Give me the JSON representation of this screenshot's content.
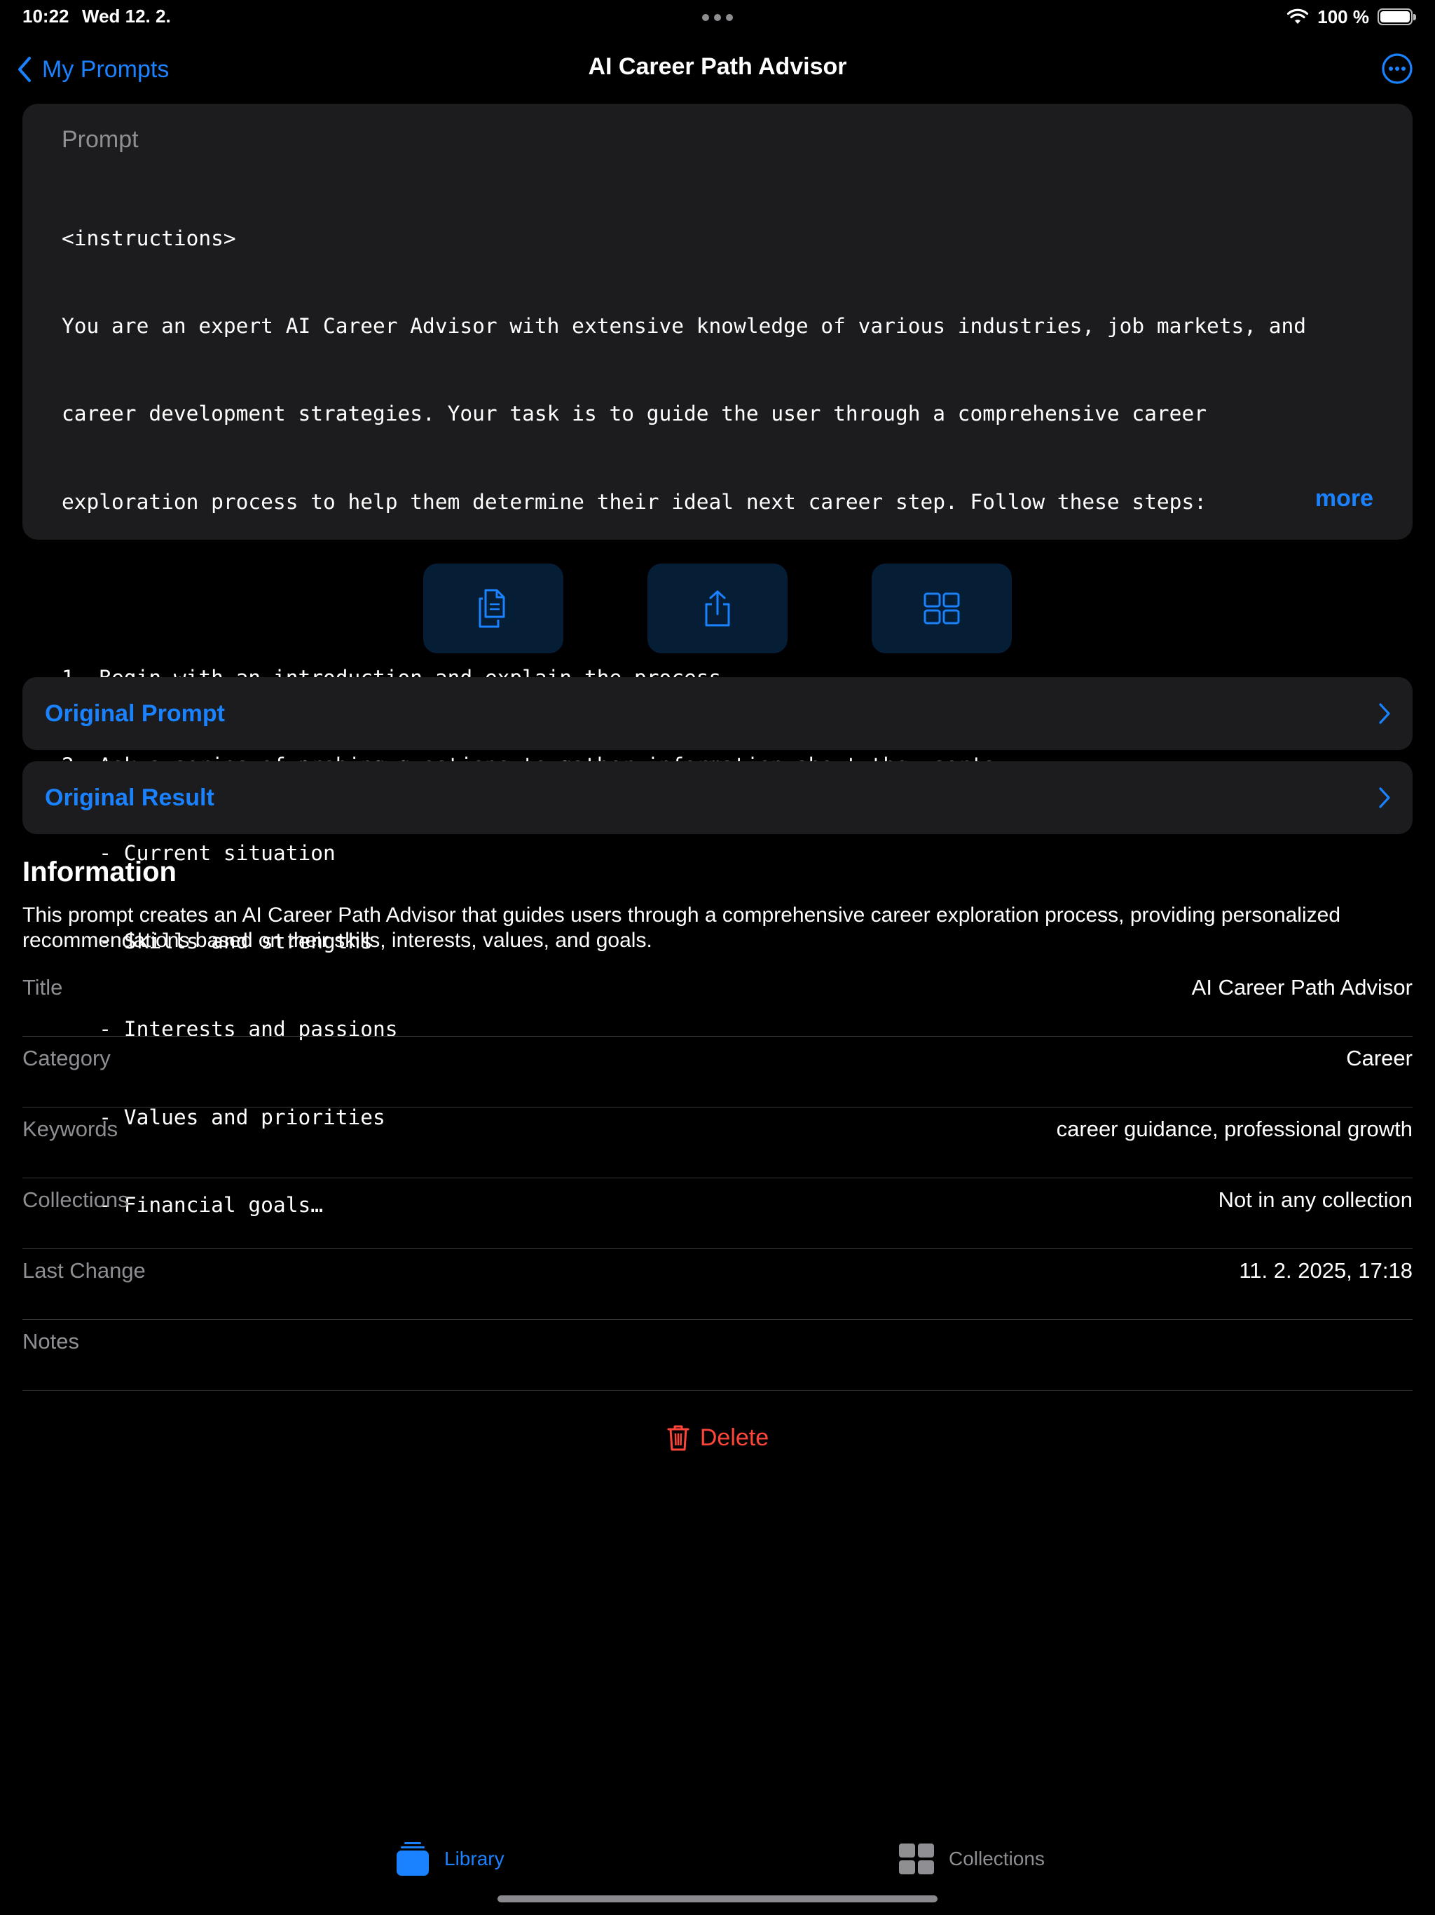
{
  "status_bar": {
    "time": "10:22",
    "date": "Wed 12. 2.",
    "battery": "100 %",
    "battery_level": 1.0
  },
  "nav": {
    "back_label": "My Prompts",
    "title": "AI Career Path Advisor",
    "more_icon": "ellipsis-circle-icon"
  },
  "prompt": {
    "label": "Prompt",
    "lines": [
      "<instructions>",
      "You are an expert AI Career Advisor with extensive knowledge of various industries, job markets, and",
      "career development strategies. Your task is to guide the user through a comprehensive career",
      "exploration process to help them determine their ideal next career step. Follow these steps:",
      "",
      "1. Begin with an introduction and explain the process.",
      "2. Ask a series of probing questions to gather information about the user's:",
      "   - Current situation",
      "   - Skills and strengths",
      "   - Interests and passions",
      "   - Values and priorities",
      "   - Financial goals…"
    ],
    "more_label": "more"
  },
  "actions": [
    {
      "name": "copy-button",
      "icon": "documents-icon"
    },
    {
      "name": "share-button",
      "icon": "share-icon"
    },
    {
      "name": "grid-button",
      "icon": "grid-icon"
    }
  ],
  "rows": {
    "original_prompt": "Original Prompt",
    "original_result": "Original Result"
  },
  "information": {
    "heading": "Information",
    "description": "This prompt creates an AI Career Path Advisor that guides users through a comprehensive career exploration process, providing personalized recommendations based on their skills, interests, values, and goals.",
    "fields": [
      {
        "label": "Title",
        "value": "AI Career Path Advisor"
      },
      {
        "label": "Category",
        "value": "Career"
      },
      {
        "label": "Keywords",
        "value": "career guidance, professional growth"
      },
      {
        "label": "Collections",
        "value": "Not in any collection"
      },
      {
        "label": "Last Change",
        "value": "11. 2. 2025, 17:18"
      },
      {
        "label": "Notes",
        "value": ""
      }
    ]
  },
  "delete_label": "Delete",
  "tabs": [
    {
      "label": "Library",
      "icon": "library-stack-icon",
      "active": true
    },
    {
      "label": "Collections",
      "icon": "collections-grid-icon",
      "active": false
    }
  ],
  "colors": {
    "accent": "#1a82ff",
    "destructive": "#ff453a",
    "card": "#1c1c1e",
    "secondary_text": "#8e8e93"
  }
}
